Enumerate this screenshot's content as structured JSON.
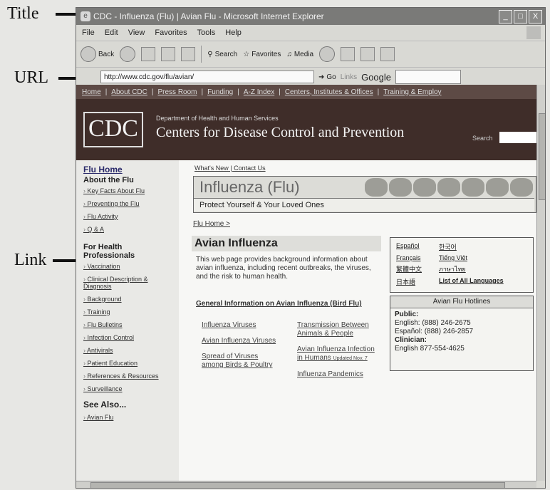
{
  "callouts": {
    "title": "Title",
    "url": "URL",
    "link": "Link"
  },
  "window": {
    "title": "CDC - Influenza (Flu) | Avian Flu - Microsoft Internet Explorer",
    "controls": [
      "_",
      "□",
      "X"
    ]
  },
  "menu": [
    "File",
    "Edit",
    "View",
    "Favorites",
    "Tools",
    "Help"
  ],
  "toolbar": {
    "back": "Back",
    "search": "Search",
    "favorites": "Favorites",
    "media": "Media"
  },
  "address": {
    "url": "http://www.cdc.gov/flu/avian/",
    "go": "Go",
    "links": "Links",
    "google": "Google"
  },
  "cdc": {
    "topnav": [
      "Home",
      "About CDC",
      "Press Room",
      "Funding",
      "A-Z Index",
      "Centers, Institutes & Offices",
      "Training & Employ"
    ],
    "logo": "CDC",
    "dept": "Department of Health and Human Services",
    "centers": "Centers for Disease Control and Prevention",
    "search_label": "Search"
  },
  "leftnav": {
    "flu_home": "Flu Home",
    "about_heading": "About the Flu",
    "about_links": [
      "Key Facts About Flu",
      "Preventing the Flu",
      "Flu Activity",
      "Q & A"
    ],
    "pros_heading": "For Health Professionals",
    "pros_links": [
      "Vaccination",
      "Clinical Description & Diagnosis",
      "Background",
      "Training",
      "Flu Bulletins",
      "Infection Control",
      "Antivirals",
      "Patient Education",
      "References & Resources",
      "Surveillance"
    ],
    "see_also": "See Also...",
    "see_also_links": [
      "Avian Flu"
    ]
  },
  "content": {
    "util_links": "What's New | Contact Us",
    "banner_title": "Influenza (Flu)",
    "banner_tag": "Protect Yourself & Your Loved Ones",
    "breadcrumb": "Flu Home >",
    "page_title": "Avian Influenza",
    "description": "This web page provides background information about avian influenza, including recent outbreaks, the viruses, and the risk to human health.",
    "general_link": "General Information on Avian Influenza (Bird Flu)",
    "col1": [
      "Influenza Viruses",
      "Avian Influenza Viruses",
      "Spread of Viruses among Birds & Poultry"
    ],
    "col2": [
      "Transmission Between Animals & People",
      "Avian Influenza Infection in Humans",
      "Influenza Pandemics"
    ],
    "updated_note": "Updated Nov. 7"
  },
  "languages": {
    "items": [
      "Español",
      "한국어",
      "Français",
      "Tiếng Việt",
      "繁體中文",
      "ภาษาไทย",
      "日本語"
    ],
    "all": "List of All Languages"
  },
  "hotlines": {
    "title": "Avian Flu Hotlines",
    "public_label": "Public:",
    "english_public": "English: (888) 246-2675",
    "espanol_public": "Español: (888) 246-2857",
    "clinician_label": "Clinician:",
    "english_clinician": "English 877-554-4625"
  }
}
